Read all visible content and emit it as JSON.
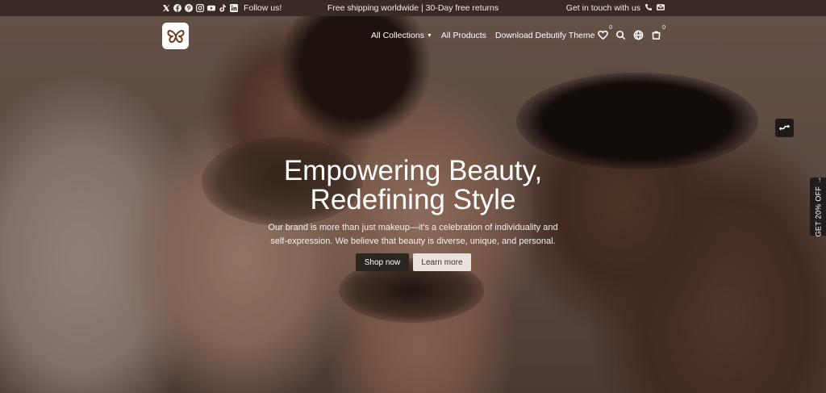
{
  "topbar": {
    "social_icons": [
      "x-icon",
      "facebook-icon",
      "pinterest-icon",
      "instagram-icon",
      "youtube-icon",
      "tiktok-icon",
      "linkedin-icon"
    ],
    "follow_label": "Follow us!",
    "announcement": "Free shipping worldwide | 30-Day free returns",
    "contact_label": "Get in touch with us",
    "contact_icons": [
      "phone-icon",
      "mail-icon"
    ]
  },
  "header": {
    "logo_icon": "butterfly-icon",
    "nav": [
      {
        "label": "All Collections",
        "has_dropdown": true
      },
      {
        "label": "All Products",
        "has_dropdown": false
      },
      {
        "label": "Download Debutify Theme",
        "has_dropdown": false
      }
    ],
    "wishlist_count": "0",
    "cart_count": "0",
    "icons": [
      "heart-icon",
      "search-icon",
      "globe-icon",
      "cart-icon"
    ]
  },
  "hero": {
    "title_line1": "Empowering Beauty,",
    "title_line2": "Redefining Style",
    "subtitle_line1": "Our brand is more than just makeup—it's a celebration of individuality and",
    "subtitle_line2": "self-expression. We believe that beauty is diverse, unique, and personal.",
    "primary_button": "Shop now",
    "secondary_button": "Learn more"
  },
  "widgets": {
    "discount_tab": "GET 20% OFF →",
    "compare_icon": "compare-arrows-icon"
  },
  "colors": {
    "topbar_bg": "#3a2a26",
    "primary_button_bg": "#2b2522",
    "secondary_button_bg": "#eae2dd"
  }
}
